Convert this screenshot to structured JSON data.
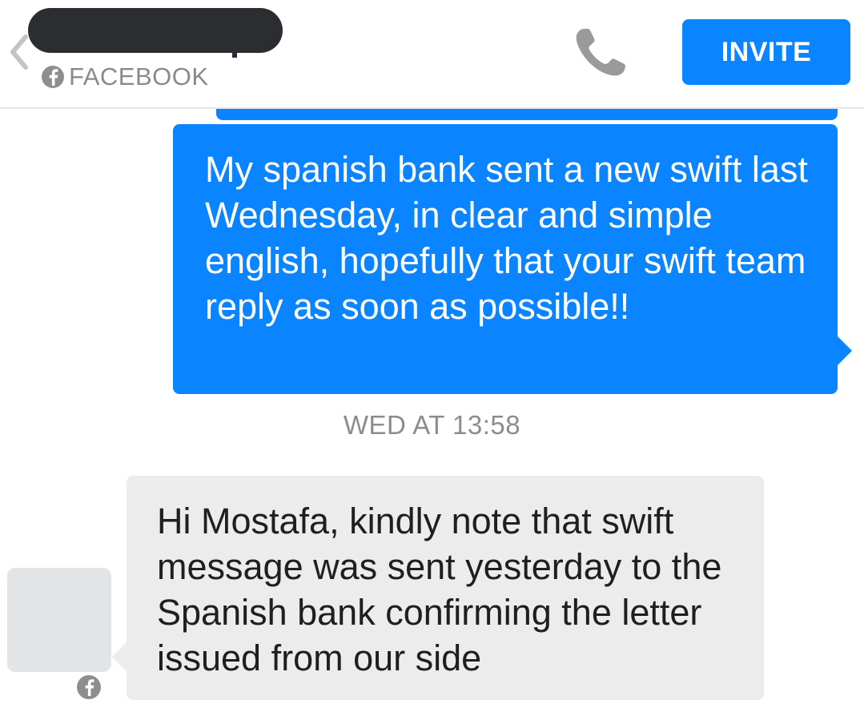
{
  "header": {
    "contact_name": "",
    "source_label": "FACEBOOK",
    "invite_label": "INVITE",
    "icons": {
      "back": "chevron-left-icon",
      "source": "facebook-icon",
      "call": "phone-icon"
    }
  },
  "conversation": {
    "messages": [
      {
        "direction": "outgoing",
        "text": "My spanish bank sent a new swift last Wednesday, in clear and simple english, hopefully that your swift team reply as soon as possible!!"
      },
      {
        "direction": "incoming",
        "text": "Hi Mostafa, kindly note that swift message was sent yesterday to the Spanish bank confirming the letter issued from our side"
      }
    ],
    "timestamp": "WED AT 13:58"
  },
  "colors": {
    "accent": "#0a84ff",
    "incoming_bubble": "#ececec",
    "muted_text": "#8a8a8a"
  }
}
